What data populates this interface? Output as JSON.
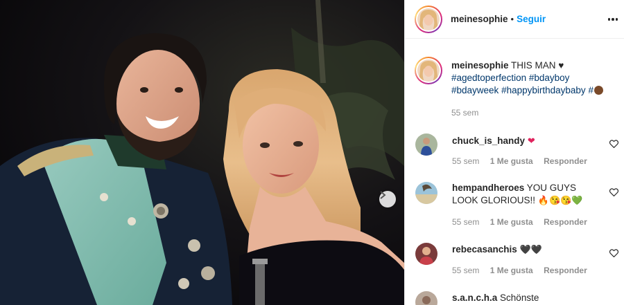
{
  "post": {
    "username": "meinesophie",
    "separator": "•",
    "follow_label": "Seguir",
    "caption": {
      "username": "meinesophie",
      "text": "THIS MAN ♥",
      "hashtags": [
        "#agedtoperfection",
        "#bdayboy",
        "#bdayweek",
        "#happybirthdaybaby",
        "#"
      ],
      "time": "55 sem"
    }
  },
  "comments": [
    {
      "username": "chuck_is_handy",
      "text": "",
      "emoji": "❤",
      "time": "55 sem",
      "likes": "1 Me gusta",
      "reply": "Responder"
    },
    {
      "username": "hempandheroes",
      "text": "YOU GUYS",
      "text2": "LOOK GLORIOUS!!",
      "emoji": "🔥😘😘💚",
      "time": "55 sem",
      "likes": "1 Me gusta",
      "reply": "Responder"
    },
    {
      "username": "rebecasanchis",
      "text": "",
      "emoji": "🖤🖤",
      "time": "55 sem",
      "likes": "1 Me gusta",
      "reply": "Responder"
    },
    {
      "username": "s.a.n.c.h.a",
      "text": "Schönste"
    }
  ],
  "icons": {
    "more": "more-options-icon",
    "next": "chevron-right-icon",
    "heart": "heart-outline-icon"
  },
  "colors": {
    "link": "#0095f6",
    "hashtag": "#00376b",
    "muted": "#8e8e8e",
    "text": "#262626"
  }
}
